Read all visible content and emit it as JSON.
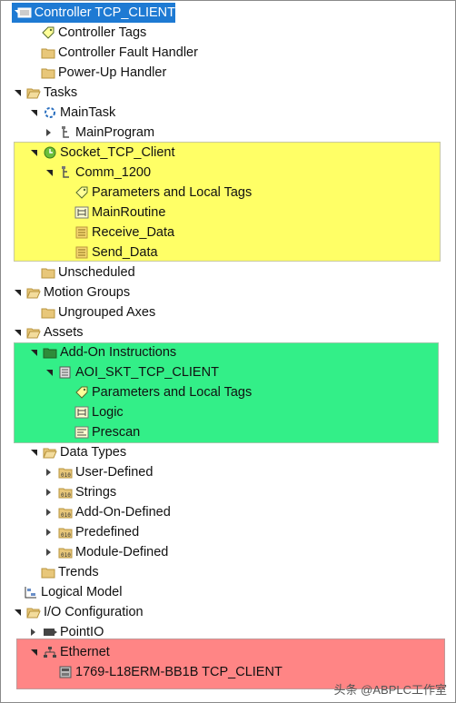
{
  "tree": {
    "controller": "Controller TCP_CLIENT",
    "controller_tags": "Controller Tags",
    "fault_handler": "Controller Fault Handler",
    "powerup_handler": "Power-Up Handler",
    "tasks": "Tasks",
    "main_task": "MainTask",
    "main_program": "MainProgram",
    "socket_task": "Socket_TCP_Client",
    "comm_program": "Comm_1200",
    "comm_params": "Parameters and Local Tags",
    "comm_main_routine": "MainRoutine",
    "comm_receive": "Receive_Data",
    "comm_send": "Send_Data",
    "unscheduled": "Unscheduled",
    "motion_groups": "Motion Groups",
    "ungrouped_axes": "Ungrouped Axes",
    "assets": "Assets",
    "aoi_folder": "Add-On Instructions",
    "aoi_name": "AOI_SKT_TCP_CLIENT",
    "aoi_params": "Parameters and Local Tags",
    "aoi_logic": "Logic",
    "aoi_prescan": "Prescan",
    "data_types": "Data Types",
    "dt_user": "User-Defined",
    "dt_strings": "Strings",
    "dt_aod": "Add-On-Defined",
    "dt_predefined": "Predefined",
    "dt_module": "Module-Defined",
    "trends": "Trends",
    "logical_model": "Logical Model",
    "io_config": "I/O Configuration",
    "point_io": "PointIO",
    "ethernet": "Ethernet",
    "module": "1769-L18ERM-BB1B TCP_CLIENT"
  },
  "watermark": "头条 @ABPLC工作室",
  "colors": {
    "selection": "#1e7ad3",
    "highlight_yellow": "#ffff66",
    "highlight_green": "#33ef88",
    "highlight_red": "#ff8585",
    "folder": "#e8c77a"
  }
}
